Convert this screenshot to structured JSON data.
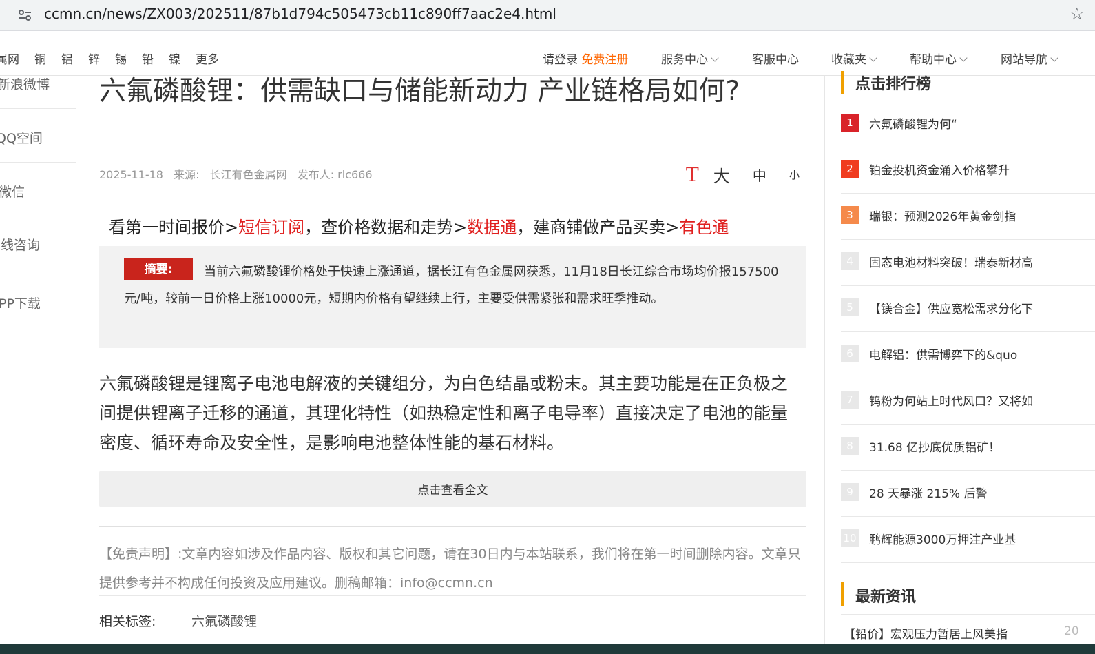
{
  "browser": {
    "url": "ccmn.cn/news/ZX003/202511/87b1d794c505473cb11c890ff7aac2e4.html"
  },
  "nav": {
    "metals": [
      "属网",
      "铜",
      "铝",
      "锌",
      "锡",
      "铅",
      "镍",
      "更多"
    ],
    "login": "请登录",
    "register": "免费注册",
    "service_center": "服务中心",
    "customer_center": "客服中心",
    "favorites": "收藏夹",
    "help_center": "帮助中心",
    "site_nav": "网站导航"
  },
  "share": [
    "新浪微博",
    "QQ空间",
    "微信",
    "在线咨询",
    "APP下载"
  ],
  "article": {
    "title": "六氟磷酸锂：供需缺口与储能新动力 产业链格局如何?",
    "date": "2025-11-18",
    "source_label": "来源:",
    "source": "长江有色金属网",
    "publisher": "发布人: rlc666",
    "font_sizes": {
      "large": "大",
      "medium": "中",
      "small": "小"
    },
    "promo": {
      "p1": "看第一时间报价>",
      "l1": "短信订阅",
      "p2": "，查价格数据和走势>",
      "l2": "数据通",
      "p3": "，建商铺做产品买卖>",
      "l3": "有色通"
    },
    "summary_label": "摘要:",
    "summary": "当前六氟磷酸锂价格处于快速上涨通道，据长江有色金属网获悉，11月18日长江综合市场均价报157500元/吨，较前一日价格上涨10000元，短期内价格有望继续上行，主要受供需紧张和需求旺季推动。",
    "body": "六氟磷酸锂是锂离子电池电解液的关键组分，为白色结晶或粉末。其主要功能是在正负极之间提供锂离子迁移的通道，其理化特性（如热稳定性和离子电导率）直接决定了电池的能量密度、循环寿命及安全性，是影响电池整体性能的基石材料。",
    "read_more": "点击查看全文",
    "disclaimer": "【免责声明】:文章内容如涉及作品内容、版权和其它问题，请在30日内与本站联系，我们将在第一时间删除内容。文章只提供参考并不构成任何投资及应用建议。删稿邮箱：info@ccmn.cn",
    "tags_label": "相关标签:",
    "tags": [
      "六氟磷酸锂"
    ]
  },
  "sidebar": {
    "ranking_title": "点击排行榜",
    "ranking": [
      {
        "num": "1",
        "title": "六氟磷酸锂为何“"
      },
      {
        "num": "2",
        "title": "铂金投机资金涌入价格攀升"
      },
      {
        "num": "3",
        "title": "瑞银：预测2026年黄金剑指"
      },
      {
        "num": "4",
        "title": "固态电池材料突破！瑞泰新材高"
      },
      {
        "num": "5",
        "title": "【镁合金】供应宽松需求分化下"
      },
      {
        "num": "6",
        "title": "电解铝：供需博弈下的&quo"
      },
      {
        "num": "7",
        "title": "钨粉为何站上时代风口？又将如"
      },
      {
        "num": "8",
        "title": "31.68 亿抄底优质铝矿！"
      },
      {
        "num": "9",
        "title": "28 天暴涨 215% 后警"
      },
      {
        "num": "10",
        "title": "鹏辉能源3000万押注产业基"
      }
    ],
    "rank_colors": [
      "#d9232a",
      "#f03c1f",
      "#f58a4b",
      "#e8e8e8"
    ],
    "latest_title": "最新资讯",
    "latest": [
      {
        "title": "【铅价】宏观压力暂居上风美指",
        "date": "20"
      }
    ]
  }
}
